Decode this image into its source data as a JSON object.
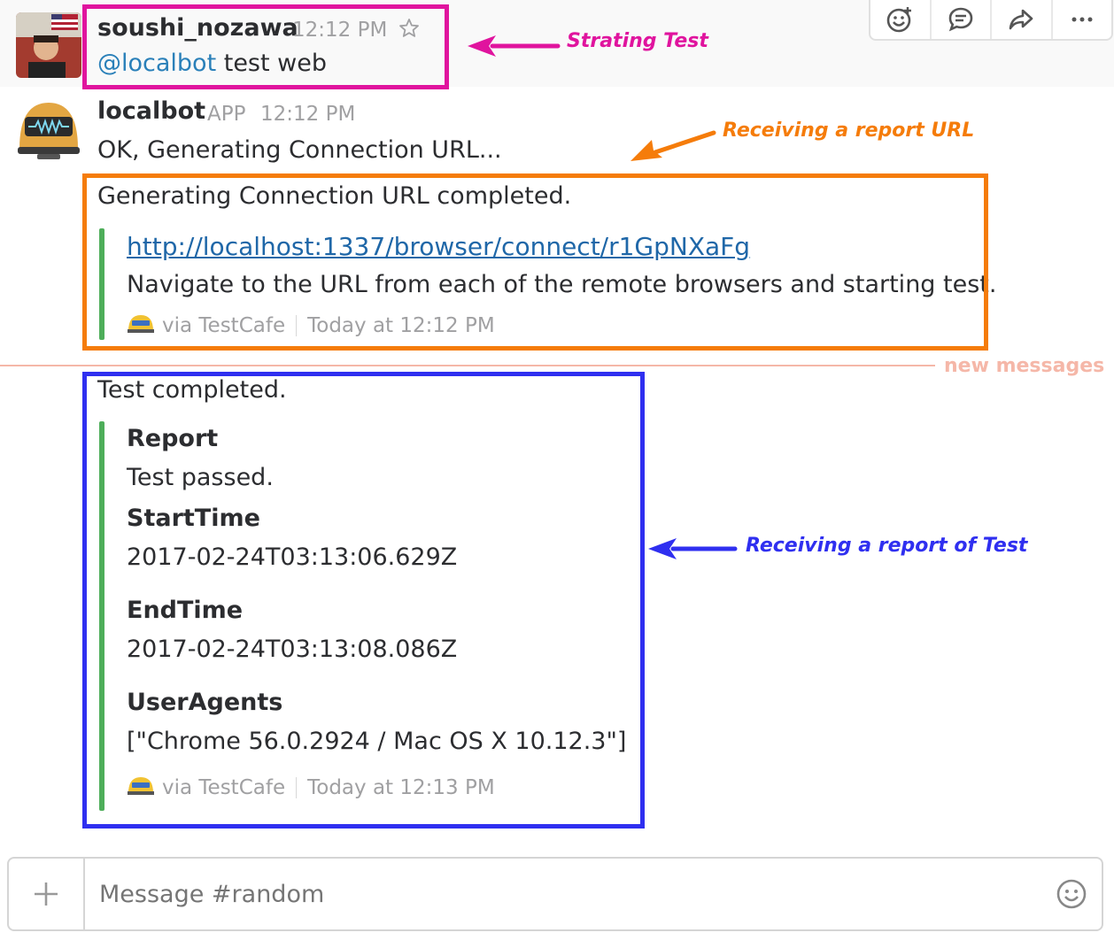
{
  "messages": [
    {
      "user": "soushi_nozawa",
      "time": "12:12 PM",
      "mention": "@localbot",
      "text": " test web"
    },
    {
      "user": "localbot",
      "badge": "APP",
      "time": "12:12 PM",
      "text": "OK, Generating Connection URL..."
    }
  ],
  "connection": {
    "heading": "Generating Connection URL completed.",
    "url": "http://localhost:1337/browser/connect/r1GpNXaFg",
    "description": "Navigate to the URL from each of the remote browsers and starting test.",
    "via": "via TestCafe",
    "timestamp": "Today at 12:12 PM"
  },
  "divider_label": "new messages",
  "report": {
    "heading": "Test completed.",
    "fields": [
      {
        "title": "Report",
        "value": "Test passed."
      },
      {
        "title": "StartTime",
        "value": "2017-02-24T03:13:06.629Z"
      },
      {
        "title": "EndTime",
        "value": "2017-02-24T03:13:08.086Z"
      },
      {
        "title": "UserAgents",
        "value": "[\"Chrome 56.0.2924 / Mac OS X 10.12.3\"]"
      }
    ],
    "via": "via TestCafe",
    "timestamp": "Today at 12:13 PM"
  },
  "annotations": {
    "start": "Strating Test",
    "url": "Receiving a report URL",
    "report": "Receiving a report of Test"
  },
  "composer": {
    "placeholder": "Message #random"
  },
  "colors": {
    "magenta": "#e0149e",
    "orange": "#f57c0a",
    "blue": "#2f2ff0",
    "attachment_bar": "#4eae5a",
    "link": "#1f67a8",
    "mention": "#2a80b9",
    "divider": "#f5b7a8"
  },
  "icons": [
    "star-icon",
    "add-reaction-icon",
    "thread-icon",
    "share-icon",
    "more-icon",
    "plus-icon",
    "emoji-icon",
    "testcafe-icon"
  ]
}
